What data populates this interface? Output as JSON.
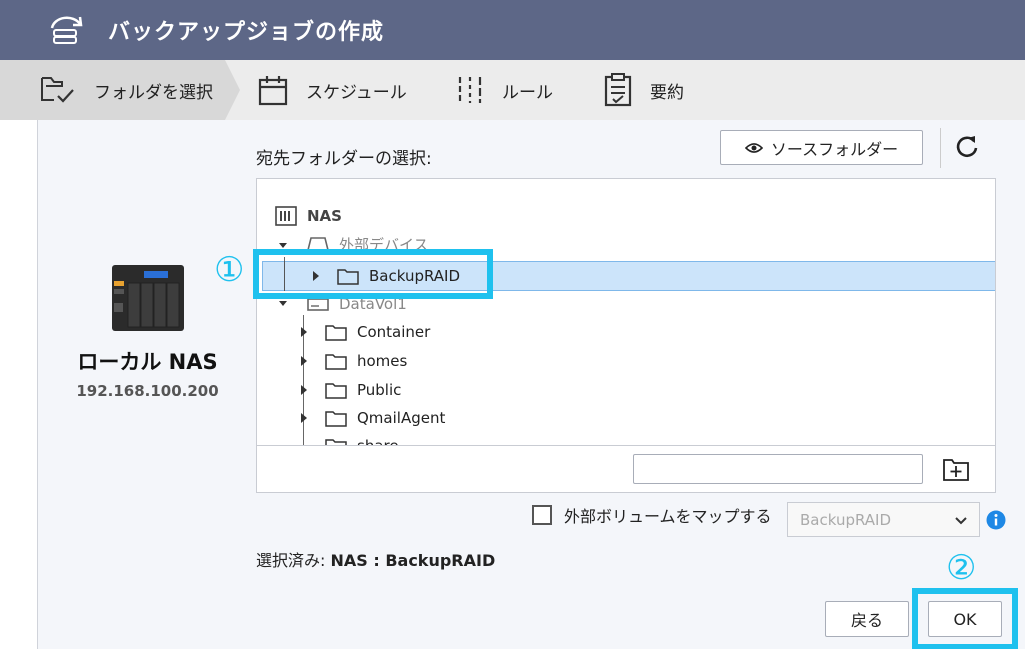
{
  "window": {
    "title": "バックアップジョブの作成",
    "icon": "backup-job-icon"
  },
  "steps": [
    {
      "label": "フォルダを選択",
      "icon": "folder-check-icon",
      "active": true
    },
    {
      "label": "スケジュール",
      "icon": "calendar-icon",
      "active": false
    },
    {
      "label": "ルール",
      "icon": "sliders-icon",
      "active": false
    },
    {
      "label": "要約",
      "icon": "clipboard-icon",
      "active": false
    }
  ],
  "device": {
    "name": "ローカル NAS",
    "ip": "192.168.100.200",
    "icon": "nas-device-icon"
  },
  "destination": {
    "label": "宛先フォルダーの選択:",
    "source_folder_button": "ソースフォルダー",
    "refresh_icon": "refresh-icon"
  },
  "tree": {
    "root": "NAS",
    "external_group": "外部デバイス",
    "selected_folder": "BackupRAID",
    "volume": "DataVol1",
    "folders": [
      "Container",
      "homes",
      "Public",
      "QmailAgent",
      "share"
    ],
    "new_folder_value": "",
    "new_folder_icon": "new-folder-icon"
  },
  "map_external": {
    "label": "外部ボリュームをマップする",
    "checked": false,
    "select_value": "BackupRAID",
    "info_icon": "info-icon"
  },
  "selection": {
    "prefix": "選択済み: ",
    "value": "NAS : BackupRAID"
  },
  "buttons": {
    "back": "戻る",
    "ok": "OK"
  },
  "callouts": {
    "one": "①",
    "two": "②",
    "color": "#1fc1ee"
  },
  "colors": {
    "titlebar": "#5d6787",
    "selection": "#cce4fa"
  }
}
